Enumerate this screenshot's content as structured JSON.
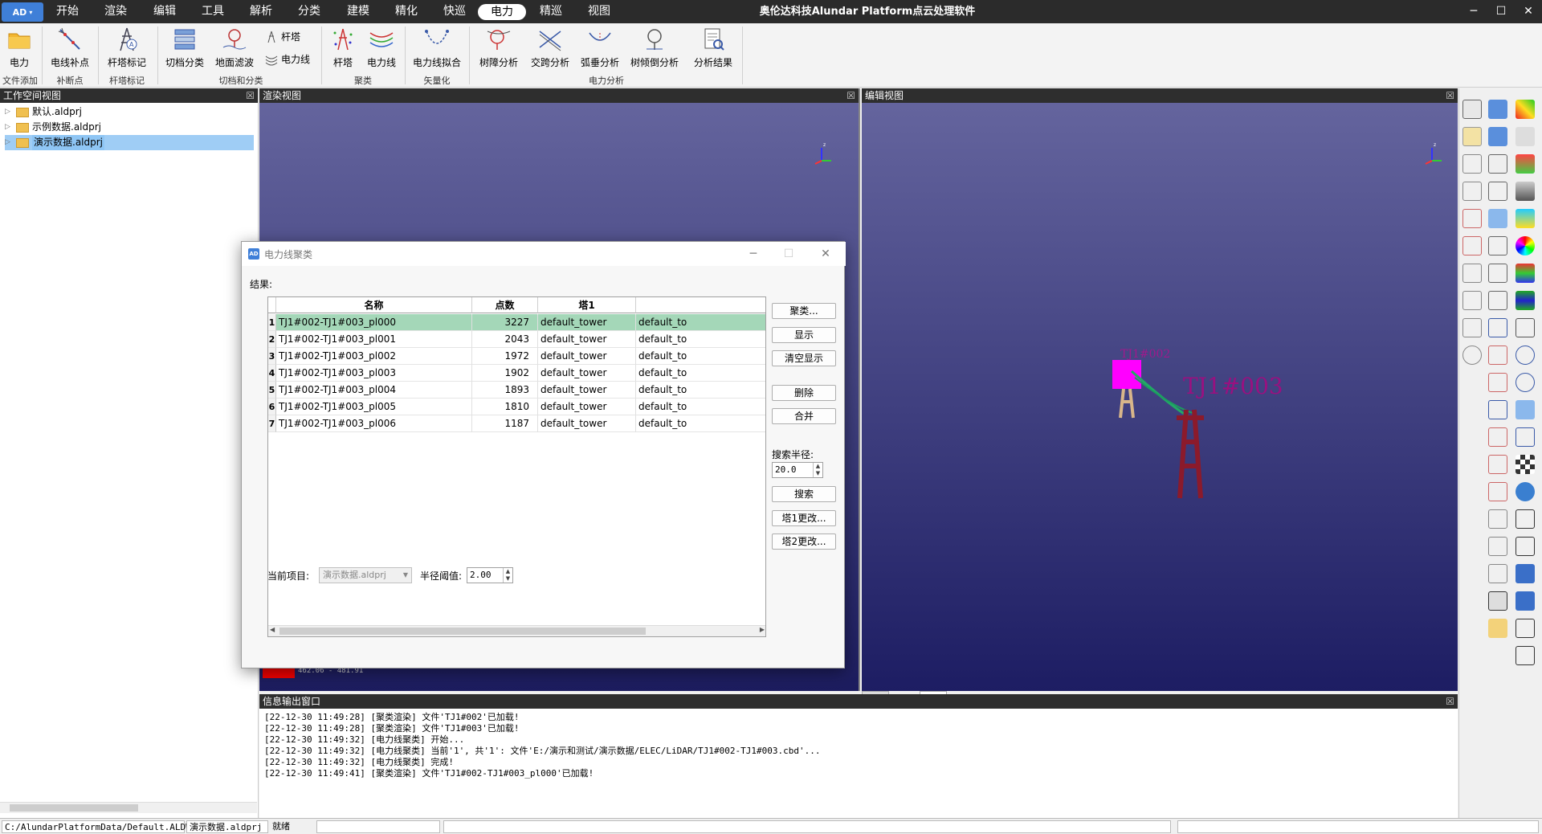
{
  "app": {
    "title": "奥伦达科技Alundar Platform点云处理软件",
    "logo": "AD",
    "menu": [
      "开始",
      "渲染",
      "编辑",
      "工具",
      "解析",
      "分类",
      "建模",
      "精化",
      "快巡",
      "电力",
      "精巡",
      "视图"
    ],
    "active_menu": "电力",
    "win_controls": [
      "─",
      "☐",
      "✕"
    ]
  },
  "ribbon": {
    "buttons": [
      {
        "label": "电力",
        "icon": "folder-icon"
      },
      {
        "label": "电线补点",
        "icon": "wire-point-icon"
      },
      {
        "label": "杆塔标记",
        "icon": "tower-mark-icon"
      },
      {
        "label": "切档分类",
        "icon": "span-classify-icon"
      },
      {
        "label": "地面滤波",
        "icon": "ground-filter-icon"
      },
      {
        "label": "杆塔",
        "icon": "tower-icon"
      },
      {
        "label": "电力线",
        "icon": "powerline-icon"
      },
      {
        "label": "电力线拟合",
        "icon": "line-fit-icon"
      },
      {
        "label": "树障分析",
        "icon": "tree-obstacle-icon"
      },
      {
        "label": "交跨分析",
        "icon": "crossing-icon"
      },
      {
        "label": "弧垂分析",
        "icon": "sag-icon"
      },
      {
        "label": "树倾倒分析",
        "icon": "tree-fall-icon"
      },
      {
        "label": "分析结果",
        "icon": "analysis-result-icon"
      }
    ],
    "small_buttons": [
      {
        "label": "杆塔",
        "icon": "tower-small-icon"
      },
      {
        "label": "电力线",
        "icon": "powerline-small-icon"
      }
    ],
    "groups": [
      "文件添加",
      "补断点",
      "杆塔标记",
      "切档和分类",
      "聚类",
      "矢量化",
      "电力分析"
    ]
  },
  "workspace": {
    "title": "工作空间视图",
    "items": [
      "默认.aldprj",
      "示例数据.aldprj",
      "演示数据.aldprj"
    ],
    "selected_index": 2
  },
  "render_view": {
    "title": "渲染视图",
    "scale_text": "462.06 - 481.91"
  },
  "edit_view": {
    "title": "编辑视图",
    "labels": [
      "TJ1#002",
      "TJ1#003"
    ],
    "tabs": [
      "影像视图",
      "编辑视图"
    ],
    "active_tab": "编辑视图"
  },
  "dialog": {
    "title": "电力线聚类",
    "result_label": "结果:",
    "columns": [
      "名称",
      "点数",
      "塔1",
      ""
    ],
    "rows": [
      {
        "n": "1",
        "name": "TJ1#002-TJ1#003_pl000",
        "count": "3227",
        "t1": "default_tower",
        "t2": "default_to"
      },
      {
        "n": "2",
        "name": "TJ1#002-TJ1#003_pl001",
        "count": "2043",
        "t1": "default_tower",
        "t2": "default_to"
      },
      {
        "n": "3",
        "name": "TJ1#002-TJ1#003_pl002",
        "count": "1972",
        "t1": "default_tower",
        "t2": "default_to"
      },
      {
        "n": "4",
        "name": "TJ1#002-TJ1#003_pl003",
        "count": "1902",
        "t1": "default_tower",
        "t2": "default_to"
      },
      {
        "n": "5",
        "name": "TJ1#002-TJ1#003_pl004",
        "count": "1893",
        "t1": "default_tower",
        "t2": "default_to"
      },
      {
        "n": "6",
        "name": "TJ1#002-TJ1#003_pl005",
        "count": "1810",
        "t1": "default_tower",
        "t2": "default_to"
      },
      {
        "n": "7",
        "name": "TJ1#002-TJ1#003_pl006",
        "count": "1187",
        "t1": "default_tower",
        "t2": "default_to"
      }
    ],
    "selected_row": 0,
    "buttons": {
      "cluster": "聚类...",
      "show": "显示",
      "clear": "清空显示",
      "delete": "删除",
      "merge": "合并",
      "search": "搜索",
      "tower1": "塔1更改...",
      "tower2": "塔2更改..."
    },
    "search_radius_label": "搜索半径:",
    "search_radius": "20.0",
    "current_project_label": "当前项目:",
    "current_project": "演示数据.aldprj",
    "radius_threshold_label": "半径阈值:",
    "radius_threshold": "2.00"
  },
  "output": {
    "title": "信息输出窗口",
    "lines": [
      "[22-12-30 11:49:28] [聚类渲染] 文件'TJ1#002'已加载!",
      "[22-12-30 11:49:28] [聚类渲染] 文件'TJ1#003'已加载!",
      "[22-12-30 11:49:32] [电力线聚类] 开始...",
      "[22-12-30 11:49:32] [电力线聚类] 当前'1', 共'1': 文件'E:/演示和测试/演示数据/ELEC/LiDAR/TJ1#002-TJ1#003.cbd'...",
      "[22-12-30 11:49:32] [电力线聚类] 完成!",
      "[22-12-30 11:49:41] [聚类渲染] 文件'TJ1#002-TJ1#003_pl000'已加载!"
    ]
  },
  "status": {
    "path": "C:/AlundarPlatformData/Default.ALDWS",
    "project": "演示数据.aldprj",
    "state": "就绪"
  },
  "colors": {
    "accent": "#3f7fd8",
    "view_top": "#66669f",
    "view_bottom": "#1c1c5e",
    "tower_highlight": "#ff00ff",
    "powerline": "#22aa66",
    "tower": "#8b1a2b",
    "selected_row": "#a4d7b8"
  }
}
